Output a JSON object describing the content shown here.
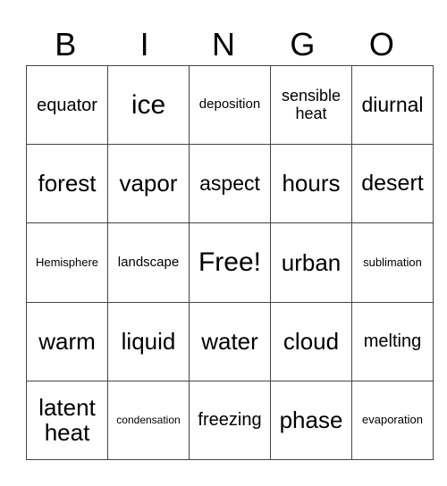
{
  "header": [
    "B",
    "I",
    "N",
    "G",
    "O"
  ],
  "rows": [
    [
      "equator",
      "ice",
      "deposition",
      "sensible heat",
      "diurnal"
    ],
    [
      "forest",
      "vapor",
      "aspect",
      "hours",
      "desert"
    ],
    [
      "Hemisphere",
      "landscape",
      "Free!",
      "urban",
      "sublimation"
    ],
    [
      "warm",
      "liquid",
      "water",
      "cloud",
      "melting"
    ],
    [
      "latent heat",
      "condensation",
      "freezing",
      "phase",
      "evaporation"
    ]
  ]
}
